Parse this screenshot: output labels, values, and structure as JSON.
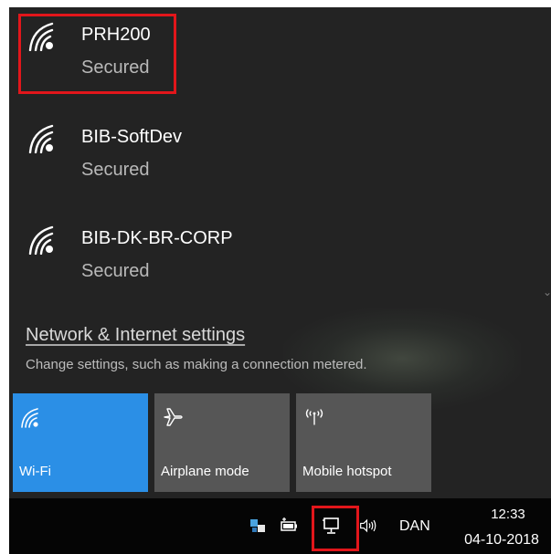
{
  "networks": [
    {
      "name": "PRH200",
      "status": "Secured",
      "icon": "wifi-signal-icon"
    },
    {
      "name": "BIB-SoftDev",
      "status": "Secured",
      "icon": "wifi-signal-icon"
    },
    {
      "name": "BIB-DK-BR-CORP",
      "status": "Secured",
      "icon": "wifi-signal-icon"
    }
  ],
  "settings": {
    "link_label": "Network & Internet settings",
    "description": "Change settings, such as making a connection metered."
  },
  "quick_actions": [
    {
      "label": "Wi-Fi",
      "icon": "wifi-icon",
      "active": true
    },
    {
      "label": "Airplane mode",
      "icon": "airplane-icon",
      "active": false
    },
    {
      "label": "Mobile hotspot",
      "icon": "mobile-hotspot-icon",
      "active": false
    }
  ],
  "taskbar": {
    "language": "DAN",
    "time": "12:33",
    "date": "04-10-2018",
    "icons": [
      "bluetooth-devices-icon",
      "battery-icon",
      "network-icon",
      "volume-icon"
    ]
  },
  "colors": {
    "flyout_background": "#232323",
    "accent": "#2b8fe6",
    "tile_inactive": "#565656",
    "highlight": "#e2161b",
    "taskbar_background": "#050505"
  }
}
